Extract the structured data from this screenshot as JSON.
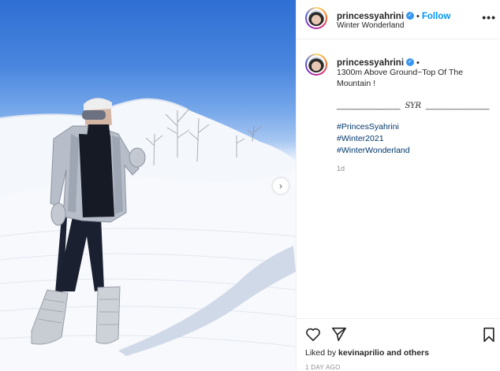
{
  "post": {
    "username": "princessyahrini",
    "follow_label": "Follow",
    "separator": "•",
    "location": "Winter Wonderland",
    "more_label": "•••",
    "next_arrow": "›"
  },
  "caption": {
    "username": "princessyahrini",
    "separator": "•",
    "text": "1300m Above Ground~Top Of The Mountain !",
    "signature_left": "_______________",
    "signature_mark": "SYR",
    "signature_right": "_______________",
    "hashtags": [
      "#PrincesSyahrini",
      "#Winter2021",
      "#WinterWonderland"
    ],
    "age": "1d"
  },
  "footer": {
    "liked_by_prefix": "Liked by",
    "liked_by_user": "kevinaprilio",
    "liked_by_suffix": "and others",
    "timestamp": "1 DAY AGO"
  },
  "icons": {
    "verified": "verified-badge-icon",
    "like": "heart-icon",
    "share": "paper-plane-icon",
    "save": "bookmark-icon",
    "more": "ellipsis-icon",
    "next": "chevron-right-icon"
  },
  "colors": {
    "accent": "#0095f6",
    "hashtag": "#00376b",
    "verified": "#3897f0",
    "muted": "#8e8e8e"
  }
}
